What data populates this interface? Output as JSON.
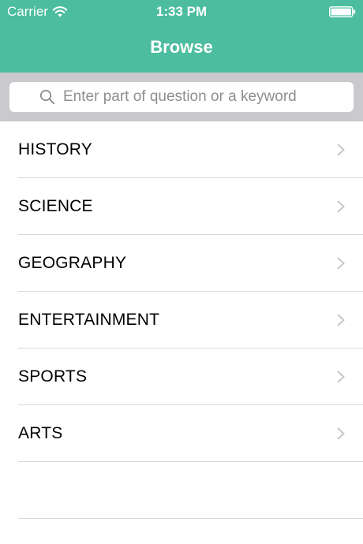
{
  "status_bar": {
    "carrier": "Carrier",
    "time": "1:33 PM",
    "wifi_icon": "wifi-icon",
    "battery_icon": "battery-icon"
  },
  "header": {
    "title": "Browse",
    "background_color": "#4cbd9e"
  },
  "search": {
    "placeholder": "Enter part of question or a keyword",
    "value": "",
    "icon": "search-icon"
  },
  "categories": [
    {
      "label": "HISTORY"
    },
    {
      "label": "SCIENCE"
    },
    {
      "label": "GEOGRAPHY"
    },
    {
      "label": "ENTERTAINMENT"
    },
    {
      "label": "SPORTS"
    },
    {
      "label": "ARTS"
    }
  ],
  "row_icon": "chevron-right-icon"
}
